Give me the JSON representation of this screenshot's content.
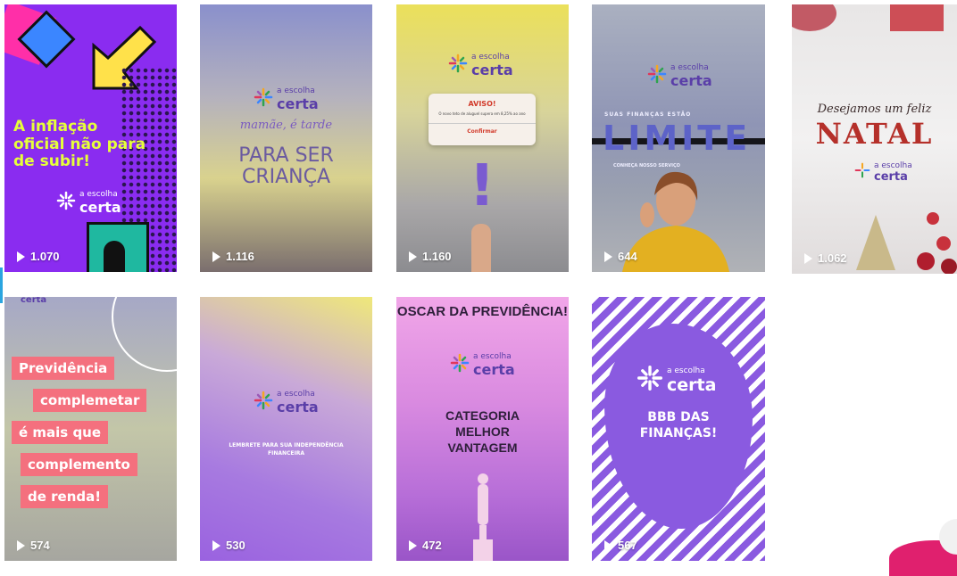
{
  "logo": {
    "small": "a escolha",
    "big": "certa"
  },
  "tiles": [
    {
      "views": "1.070",
      "title": "A inflação oficial não para de subir!"
    },
    {
      "views": "1.116",
      "script": "mamãe, é tarde",
      "title": "PARA SER CRIANÇA"
    },
    {
      "views": "1.160",
      "alert_title": "AVISO!",
      "alert_body": "O novo teto de aluguel supera em 8,25% ao ano",
      "alert_button": "Confirmar",
      "mark": "!"
    },
    {
      "views": "644",
      "top": "SUAS FINANÇAS ESTÃO",
      "title": "LIMITE",
      "sub": "CONHEÇA NOSSO SERVIÇO"
    },
    {
      "views": "1.062",
      "script": "Desejamos um feliz",
      "title": "NATAL"
    },
    {
      "views": "574",
      "lines": [
        "Previdência",
        "complemetar",
        "é mais que",
        "complemento",
        "de renda!"
      ]
    },
    {
      "views": "530",
      "title": "LEMBRETE PARA SUA INDEPENDÊNCIA FINANCEIRA"
    },
    {
      "views": "472",
      "top": "OSCAR DA PREVIDÊNCIA!",
      "title": "CATEGORIA MELHOR VANTAGEM"
    },
    {
      "views": "567",
      "title": "BBB DAS FINANÇAS!"
    }
  ]
}
